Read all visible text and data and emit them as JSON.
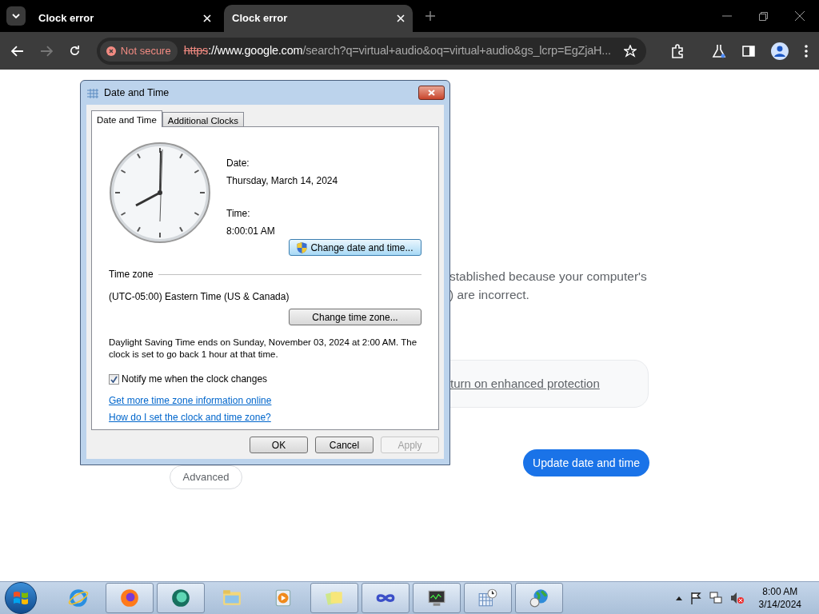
{
  "browser": {
    "tabs": [
      {
        "title": "Clock error",
        "selected": false
      },
      {
        "title": "Clock error",
        "selected": true
      }
    ],
    "address": {
      "security_label": "Not secure",
      "scheme": "https",
      "host": "://www.google.com",
      "path": "/search?q=virtual+audio&oq=virtual+audio&gs_lcrp=EgZjaH..."
    }
  },
  "page": {
    "lines": [
      "stablished because your computer's",
      ") are incorrect."
    ],
    "protection_link": "turn on enhanced protection",
    "advanced_button": "Advanced",
    "update_button": "Update date and time"
  },
  "dialog": {
    "title": "Date and Time",
    "tabs": [
      {
        "label": "Date and Time",
        "selected": true
      },
      {
        "label": "Additional Clocks",
        "selected": false
      }
    ],
    "date_label": "Date:",
    "date": "Thursday, March 14, 2024",
    "time_label": "Time:",
    "time": "8:00:01 AM",
    "change_date_button": "Change date and time...",
    "time_zone_heading": "Time zone",
    "time_zone": "(UTC-05:00) Eastern Time (US & Canada)",
    "change_zone_button": "Change time zone...",
    "dst_note": "Daylight Saving Time ends on Sunday, November 03, 2024 at 2:00 AM. The clock is set to go back 1 hour at that time.",
    "notify": {
      "label": "Notify me when the clock changes",
      "checked": true
    },
    "links": [
      "Get more time zone information online",
      "How do I set the clock and time zone?"
    ],
    "buttons": [
      {
        "label": "OK",
        "disabled": false
      },
      {
        "label": "Cancel",
        "disabled": false
      },
      {
        "label": "Apply",
        "disabled": true
      }
    ]
  },
  "taskbar": {
    "apps": [
      {
        "kind": "ie",
        "running": false
      },
      {
        "kind": "firefox",
        "running": true
      },
      {
        "kind": "chat",
        "running": true
      },
      {
        "kind": "folder",
        "running": false
      },
      {
        "kind": "media",
        "running": false
      },
      {
        "kind": "notes",
        "running": true
      },
      {
        "kind": "infinity",
        "running": true
      },
      {
        "kind": "monitor",
        "running": true
      },
      {
        "kind": "calendar",
        "running": true
      },
      {
        "kind": "globe",
        "running": true
      }
    ],
    "clock": {
      "time": "8:00 AM",
      "date": "3/14/2024"
    }
  }
}
